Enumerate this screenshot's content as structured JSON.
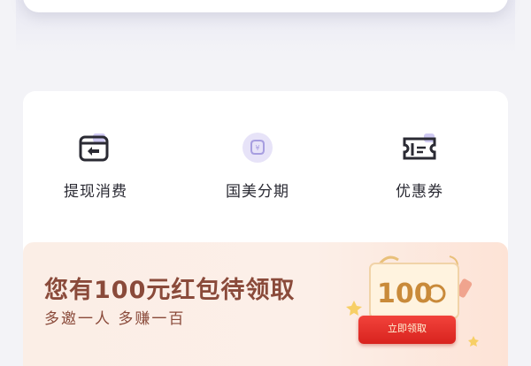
{
  "services": [
    {
      "label": "提现消费",
      "icon": "cash-withdraw-icon"
    },
    {
      "label": "国美分期",
      "icon": "installment-icon"
    },
    {
      "label": "优惠券",
      "icon": "coupon-icon"
    }
  ],
  "promo": {
    "title": "您有100元红包待领取",
    "subtitle": "多邀一人 多赚一百",
    "badge_value": "100",
    "button_label": "立即领取"
  },
  "colors": {
    "accent_red": "#e0312a",
    "promo_text": "#8a4a3a",
    "icon_purple": "#b8b0e8"
  }
}
